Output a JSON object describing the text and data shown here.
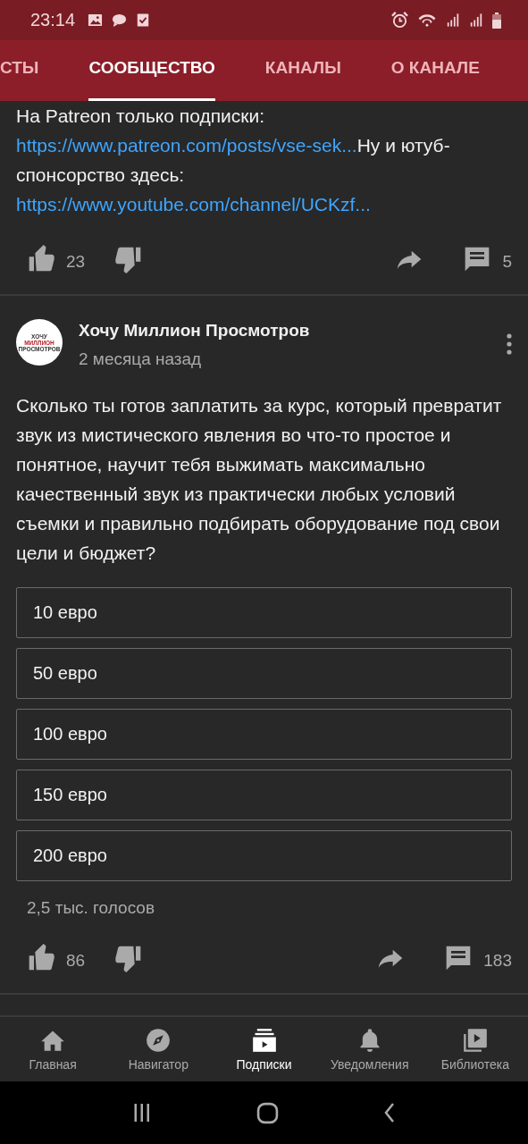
{
  "status_bar": {
    "time": "23:14"
  },
  "tabs": [
    {
      "label": "СТЫ",
      "selected": false
    },
    {
      "label": "СООБЩЕСТВО",
      "selected": true
    },
    {
      "label": "КАНАЛЫ",
      "selected": false
    },
    {
      "label": "О КАНАЛЕ",
      "selected": false
    }
  ],
  "posts": [
    {
      "text": [
        {
          "kind": "text",
          "value": "На Patreon только подписки: "
        },
        {
          "kind": "link",
          "value": "https://www.patreon.com/posts/vse-sek..."
        },
        {
          "kind": "text",
          "value": "Ну и ютуб-спонсорство здесь: "
        },
        {
          "kind": "link",
          "value": "https://www.youtube.com/channel/UCKzf..."
        }
      ],
      "likes": "23",
      "comments": "5"
    },
    {
      "author": "Хочу Миллион Просмотров",
      "avatar_lines": [
        "ХОЧУ",
        "МИЛЛИОН",
        "ПРОСМОТРОВ"
      ],
      "time": "2 месяца назад",
      "text": [
        {
          "kind": "text",
          "value": "Сколько ты готов заплатить за курс, который превратит звук из мистического явления во что-то простое и понятное, научит тебя выжимать максимально качественный звук из практически любых условий съемки и правильно подбирать оборудование под свои цели и бюджет?"
        }
      ],
      "poll": {
        "options": [
          "10 евро",
          "50 евро",
          "100 евро",
          "150 евро",
          "200 евро"
        ],
        "votes": "2,5 тыс. голосов"
      },
      "likes": "86",
      "comments": "183"
    }
  ],
  "bottom_nav": [
    {
      "label": "Главная",
      "kind": "home",
      "selected": false
    },
    {
      "label": "Навигатор",
      "kind": "compass",
      "selected": false
    },
    {
      "label": "Подписки",
      "kind": "subscriptions",
      "selected": true
    },
    {
      "label": "Уведомления",
      "kind": "bell",
      "selected": false
    },
    {
      "label": "Библиотека",
      "kind": "library",
      "selected": false
    }
  ]
}
